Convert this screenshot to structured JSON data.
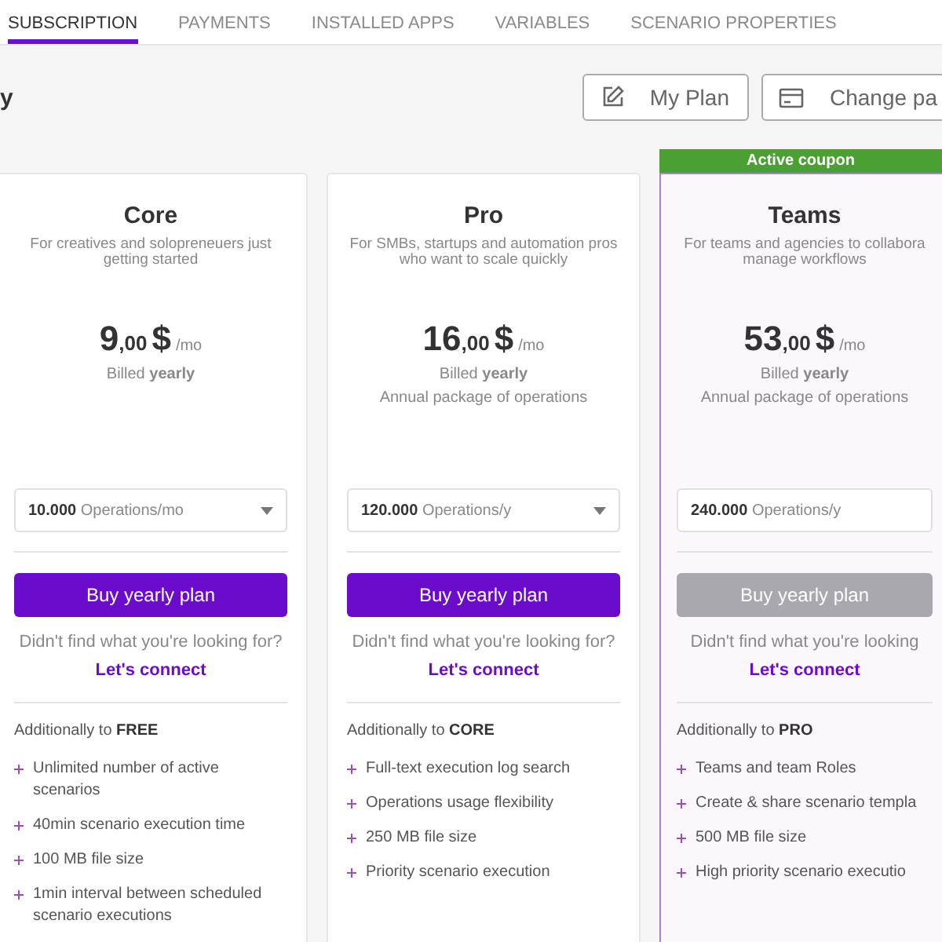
{
  "tabs": [
    {
      "label": "SUBSCRIPTION",
      "selected": true
    },
    {
      "label": "PAYMENTS",
      "selected": false
    },
    {
      "label": "INSTALLED APPS",
      "selected": false
    },
    {
      "label": "VARIABLES",
      "selected": false
    },
    {
      "label": "SCENARIO PROPERTIES",
      "selected": false
    }
  ],
  "heading": "y",
  "actions": [
    {
      "kind": "edit",
      "label": "My Plan"
    },
    {
      "kind": "card",
      "label": "Change pa"
    }
  ],
  "plans": [
    {
      "name": "Core",
      "description": "For creatives and solopreneuers just getting started",
      "highlighted": false,
      "price": {
        "amount": "9",
        "decimals": ",00",
        "currency": "$",
        "period": "/mo"
      },
      "billing": "Billed **yearly**",
      "operations": {
        "value": "10.000 ",
        "unit": "Operations/mo"
      },
      "button": {
        "label": "Buy yearly plan",
        "disabled": false
      },
      "help": "Didn't find what you're looking for?",
      "link": "Let's connect",
      "features_heading": "Additionally to **FREE**",
      "features": [
        "Unlimited number of active scenarios",
        "40min scenario execution time",
        "100 MB file size",
        "1min interval between scheduled scenario executions"
      ]
    },
    {
      "name": "Pro",
      "description": "For SMBs, startups and automation pros who want to scale quickly",
      "highlighted": false,
      "price": {
        "amount": "16",
        "decimals": ",00",
        "currency": "$",
        "period": "/mo"
      },
      "billing": "Billed **yearly**",
      "note": "Annual package of operations",
      "operations": {
        "value": "120.000 ",
        "unit": "Operations/y"
      },
      "button": {
        "label": "Buy yearly plan",
        "disabled": false
      },
      "help": "Didn't find what you're looking for?",
      "link": "Let's connect",
      "features_heading": "Additionally to **CORE**",
      "features": [
        "Full-text execution log search",
        "Operations usage flexibility",
        "250 MB file size",
        "Priority scenario execution"
      ]
    },
    {
      "name": "Teams",
      "coupon": "Active coupon",
      "description": "For teams and agencies to collabora manage workflows",
      "highlighted": true,
      "price": {
        "amount": "53",
        "decimals": ",00",
        "currency": "$",
        "period": "/mo"
      },
      "billing": "Billed **yearly**",
      "note": "Annual package of operations",
      "operations": {
        "value": "240.000 ",
        "unit": "Operations/y"
      },
      "button": {
        "label": "Buy yearly plan",
        "disabled": true
      },
      "help": "Didn't find what you're looking",
      "link": "Let's connect",
      "features_heading": "Additionally to **PRO**",
      "features": [
        "Teams and team Roles",
        "Create & share scenario templa",
        "500 MB file size",
        "High priority scenario executio"
      ]
    }
  ]
}
